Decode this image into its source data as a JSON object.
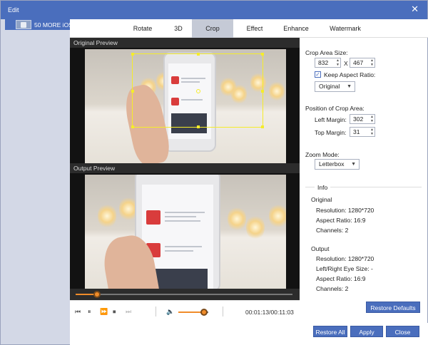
{
  "window": {
    "title": "Edit",
    "close_glyph": "✕"
  },
  "file_list": {
    "items": [
      {
        "label": "50 MORE iOS ..."
      }
    ]
  },
  "tabs": [
    {
      "label": "Rotate"
    },
    {
      "label": "3D"
    },
    {
      "label": "Crop",
      "active": true
    },
    {
      "label": "Effect"
    },
    {
      "label": "Enhance"
    },
    {
      "label": "Watermark"
    }
  ],
  "original_preview": {
    "title": "Original Preview"
  },
  "output_preview": {
    "title": "Output Preview"
  },
  "playback": {
    "progress_fraction": 0.1,
    "volume_fraction": 0.85,
    "time": "00:01:13/00:11:03",
    "icons": [
      "prev-icon",
      "pause-icon",
      "fast-forward-icon",
      "stop-icon",
      "next-icon",
      "volume-icon"
    ]
  },
  "crop": {
    "area_size_label": "Crop Area Size:",
    "width": "832",
    "x_label": "X",
    "height": "467",
    "keep_aspect_label": "Keep Aspect Ratio:",
    "keep_aspect_checked": true,
    "aspect_value": "Original",
    "position_label": "Position of Crop Area:",
    "left_margin_label": "Left Margin:",
    "left_margin": "302",
    "top_margin_label": "Top Margin:",
    "top_margin": "31",
    "zoom_label": "Zoom Mode:",
    "zoom_value": "Letterbox"
  },
  "info": {
    "title": "Info",
    "original_title": "Original",
    "original_resolution": "Resolution: 1280*720",
    "original_aspect": "Aspect Ratio: 16:9",
    "original_channels": "Channels: 2",
    "output_title": "Output",
    "output_resolution": "Resolution: 1280*720",
    "output_eye": "Left/Right Eye Size: -",
    "output_aspect": "Aspect Ratio: 16:9",
    "output_channels": "Channels: 2"
  },
  "buttons": {
    "restore_defaults": "Restore Defaults",
    "restore_all": "Restore All",
    "apply": "Apply",
    "close": "Close"
  },
  "colors": {
    "accent": "#4a6ebd",
    "crop_box": "#f5ec2a",
    "slider": "#f08c2a"
  }
}
